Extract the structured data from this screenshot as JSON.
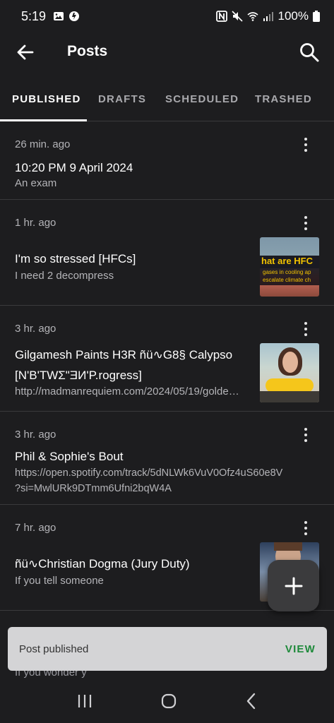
{
  "status": {
    "time": "5:19",
    "battery": "100%"
  },
  "app_bar": {
    "title": "Posts"
  },
  "tabs": [
    {
      "label": "PUBLISHED",
      "active": true
    },
    {
      "label": "DRAFTS"
    },
    {
      "label": "SCHEDULED"
    },
    {
      "label": "TRASHED"
    }
  ],
  "posts": [
    {
      "time": "26 min. ago",
      "title": "10:20 PM 9 April 2024",
      "subtitle": "An exam"
    },
    {
      "time": "1 hr. ago",
      "title": "I'm so stressed [HFCs]",
      "subtitle": "I need 2 decompress",
      "thumb_text_1": "hat are HFC",
      "thumb_text_2": "gases in cooling ap",
      "thumb_text_3": "escalate climate ch"
    },
    {
      "time": "3 hr. ago",
      "title_line1": "Gilgamesh Paints H3R ñü∿G8§ Calypso",
      "title_line2": "[N'B'TWΣ\"ƎИ'P.rogress]",
      "subtitle": "http://madmanrequiem.com/2024/05/19/golde…"
    },
    {
      "time": "3 hr. ago",
      "title": "Phil & Sophie's Bout",
      "subtitle_line1": "https://open.spotify.com/track/5dNLWk6VuV0Ofz4uS60e8V",
      "subtitle_line2": "?si=MwlURk9DTmm6Ufni2bqW4A"
    },
    {
      "time": "7 hr. ago",
      "title": "ñü∿Christian Dogma (Jury Duty)",
      "subtitle": "If you tell someone"
    }
  ],
  "behind_text": "If you wonder y",
  "snackbar": {
    "message": "Post published",
    "action": "VIEW"
  },
  "colors": {
    "background": "#1d1d1f",
    "accent_action": "#1f8a3b",
    "snackbar_bg": "#d4d4d6"
  }
}
